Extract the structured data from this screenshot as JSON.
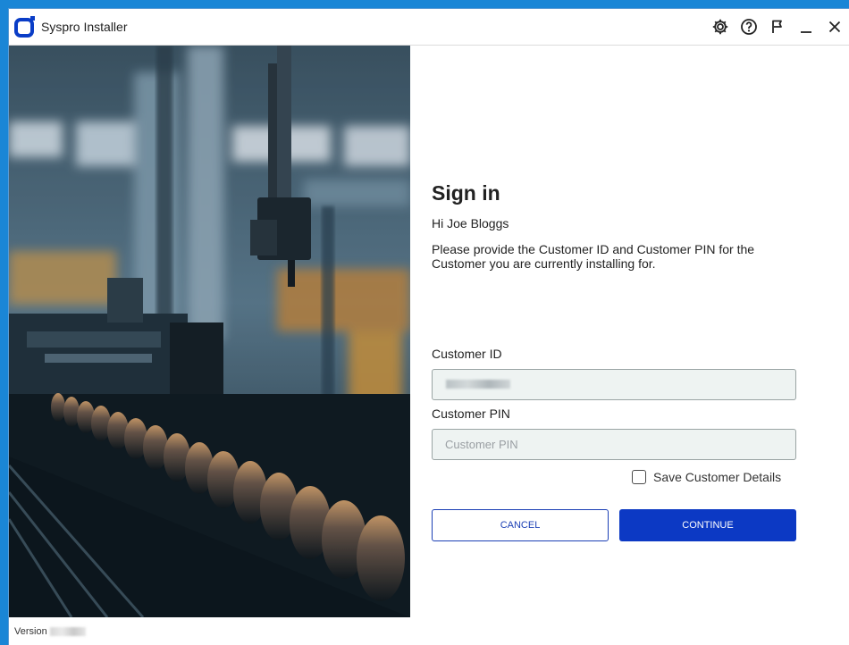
{
  "window": {
    "title": "Syspro Installer",
    "icons": [
      "settings-gear-icon",
      "help-icon",
      "flag-icon",
      "minimize-icon",
      "close-icon"
    ]
  },
  "colors": {
    "accent": "#0c39c4",
    "desktop": "#1a86d6",
    "field_bg": "#eef3f2"
  },
  "footer": {
    "version_label": "Version"
  },
  "signin": {
    "heading": "Sign in",
    "greeting": "Hi Joe Bloggs",
    "description": "Please provide the Customer ID and Customer PIN for the Customer you are currently installing for.",
    "customer_id_label": "Customer ID",
    "customer_pin_label": "Customer PIN",
    "customer_pin_placeholder": "Customer PIN",
    "save_details_label": "Save Customer Details",
    "cancel_label": "CANCEL",
    "continue_label": "CONTINUE"
  }
}
